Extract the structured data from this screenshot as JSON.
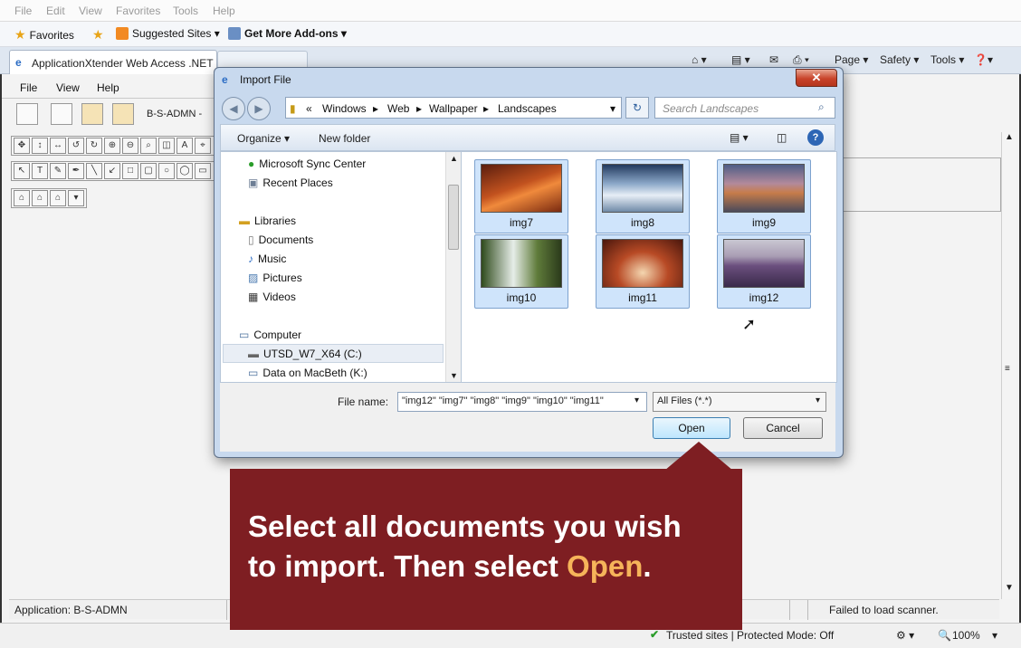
{
  "ie": {
    "menu": [
      "File",
      "Edit",
      "View",
      "Favorites",
      "Tools",
      "Help"
    ],
    "favorites_label": "Favorites",
    "suggested_sites": "Suggested Sites ▾",
    "get_addons": "Get More Add-ons ▾",
    "tab_title": "ApplicationXtender Web Access .NET",
    "command_bar": [
      "Page ▾",
      "Safety ▾",
      "Tools ▾"
    ],
    "status_zone": "Trusted sites | Protected Mode: Off",
    "zoom": "100%"
  },
  "app": {
    "menu": [
      "File",
      "View",
      "Help"
    ],
    "app_label": "B-S-ADMN -",
    "status_application": "Application: B-S-ADMN",
    "status_scanner": "Failed to load scanner."
  },
  "dialog": {
    "title": "Import File",
    "breadcrumb": [
      "Windows",
      "Web",
      "Wallpaper",
      "Landscapes"
    ],
    "search_placeholder": "Search Landscapes",
    "organize": "Organize ▾",
    "new_folder": "New folder",
    "nav_items": [
      {
        "label": "Microsoft Sync Center",
        "icon": "sync-icon"
      },
      {
        "label": "Recent Places",
        "icon": "recent-places-icon"
      },
      {
        "label": "Libraries",
        "icon": "libraries-icon"
      },
      {
        "label": "Documents",
        "icon": "documents-icon"
      },
      {
        "label": "Music",
        "icon": "music-icon"
      },
      {
        "label": "Pictures",
        "icon": "pictures-icon"
      },
      {
        "label": "Videos",
        "icon": "videos-icon"
      },
      {
        "label": "Computer",
        "icon": "computer-icon"
      },
      {
        "label": "UTSD_W7_X64 (C:)",
        "icon": "drive-icon"
      },
      {
        "label": "Data on MacBeth (K:)",
        "icon": "network-drive-icon"
      }
    ],
    "files": [
      "img7",
      "img8",
      "img9",
      "img10",
      "img11",
      "img12"
    ],
    "filename_label": "File name:",
    "filename_value": "\"img12\" \"img7\" \"img8\" \"img9\" \"img10\" \"img11\"",
    "filetype": "All Files (*.*)",
    "open": "Open",
    "cancel": "Cancel"
  },
  "callout": {
    "line1": "Select all documents you wish",
    "line2_prefix": "to import. Then select ",
    "accent": "Open",
    "suffix": "."
  },
  "colors": {
    "callout_bg": "#7e1e22",
    "callout_accent": "#f6b45a",
    "selection": "#cfe4fb"
  }
}
